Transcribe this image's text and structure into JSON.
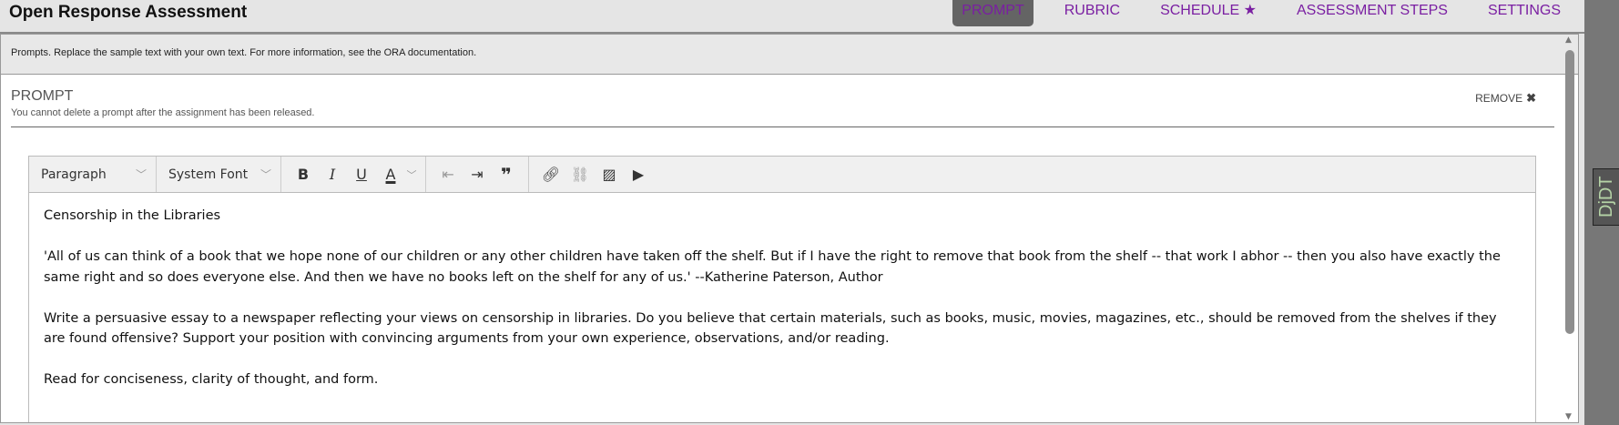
{
  "header": {
    "title": "Open Response Assessment",
    "tabs": [
      {
        "label": "PROMPT",
        "active": true
      },
      {
        "label": "RUBRIC"
      },
      {
        "label": "SCHEDULE ★"
      },
      {
        "label": "ASSESSMENT STEPS"
      },
      {
        "label": "SETTINGS"
      }
    ]
  },
  "info": "Prompts. Replace the sample text with your own text. For more information, see the ORA documentation.",
  "prompt": {
    "title": "PROMPT",
    "subtitle": "You cannot delete a prompt after the assignment has been released.",
    "remove_label": "REMOVE",
    "remove_icon": "✖"
  },
  "toolbar": {
    "block_format": "Paragraph",
    "font": "System Font",
    "icons": [
      "bold",
      "italic",
      "underline",
      "text-color",
      "outdent",
      "indent",
      "blockquote",
      "link",
      "unlink",
      "image",
      "video"
    ]
  },
  "content": [
    "Censorship in the Libraries",
    "'All of us can think of a book that we hope none of our children or any other children have taken off the shelf. But if I have the right to remove that book from the shelf -- that work I abhor -- then you also have exactly the same right and so does everyone else. And then we have no books left on the shelf for any of us.' --Katherine Paterson, Author",
    "Write a persuasive essay to a newspaper reflecting your views on censorship in libraries. Do you believe that certain materials, such as books, music, movies, magazines, etc., should be removed from the shelves if they are found offensive? Support your position with convincing arguments from your own experience, observations, and/or reading.",
    "Read for conciseness, clarity of thought, and form."
  ],
  "debug_toolbar": "DjDT",
  "colors": {
    "tab_text": "#7a1fa2",
    "active_tab_bg": "#646464"
  }
}
